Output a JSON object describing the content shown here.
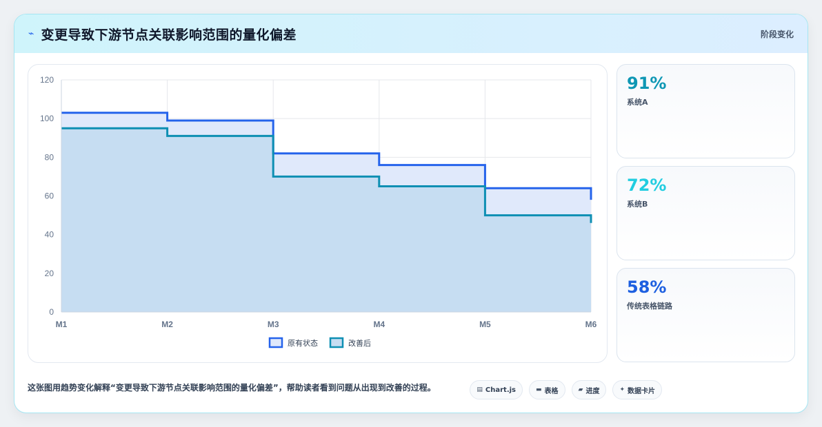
{
  "header": {
    "title": "变更导致下游节点关联影响范围的量化偏差",
    "badge": "阶段变化"
  },
  "stats": [
    {
      "value": "91%",
      "label": "系统A",
      "color": "#0e97b4"
    },
    {
      "value": "72%",
      "label": "系统B",
      "color": "#22cde0"
    },
    {
      "value": "58%",
      "label": "传统表格链路",
      "color": "#1d5fe0"
    }
  ],
  "footer": {
    "description": "这张图用趋势变化解释“变更导致下游节点关联影响范围的量化偏差”，帮助读者看到问题从出现到改善的过程。",
    "tags": [
      {
        "icon": "table-icon",
        "label": "Chart.js"
      },
      {
        "icon": "grid-icon",
        "label": "表格"
      },
      {
        "icon": "folder-icon",
        "label": "进度"
      },
      {
        "icon": "sparkle-icon",
        "label": "数据卡片"
      }
    ]
  },
  "chart_data": {
    "type": "area",
    "step": true,
    "categories": [
      "M1",
      "M2",
      "M3",
      "M4",
      "M5",
      "M6"
    ],
    "series": [
      {
        "name": "原有状态",
        "values": [
          103,
          99,
          82,
          76,
          64,
          58
        ],
        "color": "#2563eb",
        "fill": "#e0e9fb"
      },
      {
        "name": "改善后",
        "values": [
          95,
          91,
          70,
          65,
          50,
          46
        ],
        "color": "#0e8fb3",
        "fill": "#c6ddf2"
      }
    ],
    "ylim": [
      0,
      120
    ],
    "yticks": [
      0,
      20,
      40,
      60,
      80,
      100,
      120
    ],
    "grid": true,
    "legend": "bottom"
  }
}
